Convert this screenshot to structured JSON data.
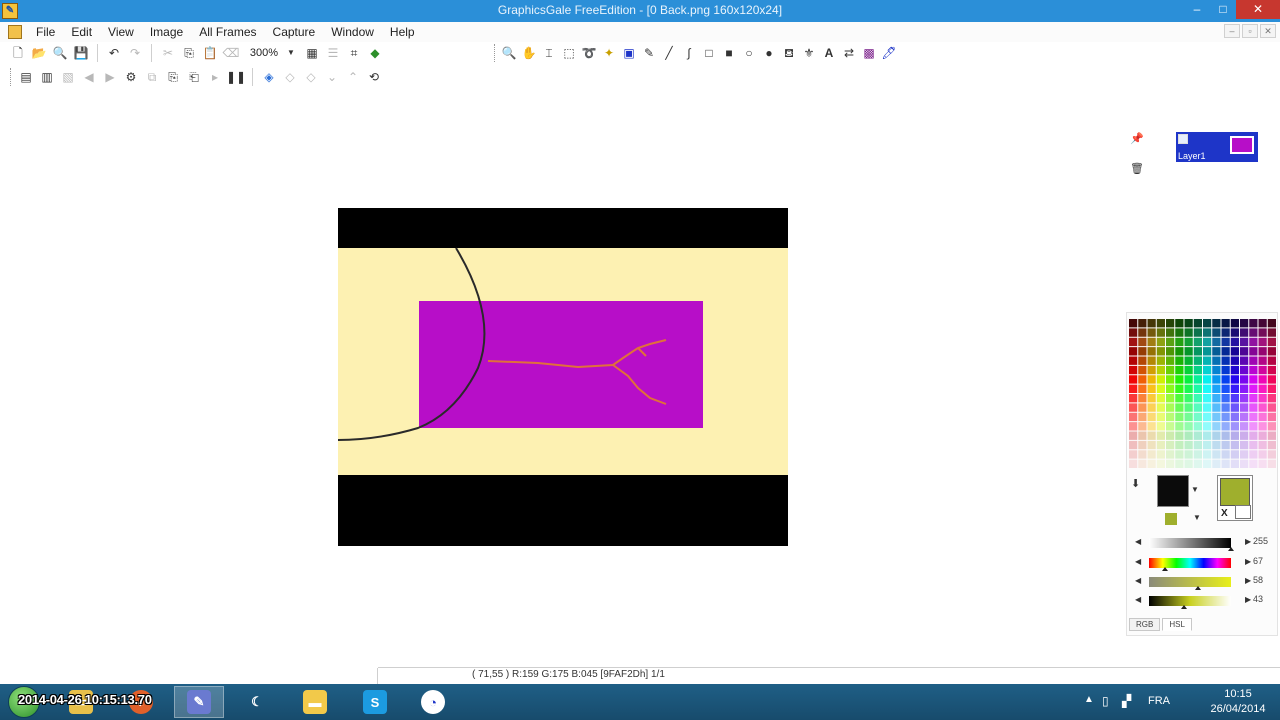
{
  "window": {
    "title": "GraphicsGale FreeEdition - [0 Back.png 160x120x24]",
    "controls": {
      "minimize": "–",
      "maximize": "□",
      "close": "✕"
    }
  },
  "menu": {
    "items": [
      "File",
      "Edit",
      "View",
      "Image",
      "All Frames",
      "Capture",
      "Window",
      "Help"
    ]
  },
  "mdi_controls": {
    "minimize": "–",
    "restore": "▫",
    "close": "✕"
  },
  "toolbar_main": {
    "zoom": "300%",
    "icons": [
      "new-icon",
      "open-icon",
      "preview-icon",
      "save-icon",
      "undo-icon",
      "redo-icon",
      "cut-icon",
      "copy-icon",
      "paste-icon",
      "delete-icon",
      "grid-icon",
      "guide-icon",
      "crop-icon",
      "transparent-icon"
    ]
  },
  "toolbar_frames": {
    "icons": [
      "frame-props-icon",
      "frame-list-icon",
      "frame-sheet-icon",
      "first-frame-icon",
      "next-frame-icon",
      "playback-settings-icon",
      "add-frame-icon",
      "insert-frame-icon",
      "delete-frame-icon",
      "play-icon",
      "pause-icon",
      "onion-icon",
      "onion-prev-icon",
      "onion-next-icon",
      "nav-prev-icon",
      "nav-next-icon",
      "export-icon"
    ]
  },
  "toolbar_tools": {
    "icons": [
      "zoom-tool-icon",
      "hand-tool-icon",
      "rect-select-icon",
      "select-icon",
      "lasso-icon",
      "magic-wand-icon",
      "color-select-icon",
      "pencil-icon",
      "line-icon",
      "curve-icon",
      "rect-icon",
      "filled-rect-icon",
      "ellipse-icon",
      "filled-ellipse-icon",
      "fill-icon",
      "spray-icon",
      "text-icon",
      "replace-color-icon",
      "gradation-icon",
      "dropper-icon"
    ]
  },
  "layers": {
    "pin": "📌",
    "trash": "🗑",
    "items": [
      {
        "name": "Layer1",
        "visible": true,
        "preview_color": "#b70ec8"
      }
    ]
  },
  "palette": {
    "foreground": "#0b0b0b",
    "background": "#9faf2d",
    "transparent": "#9faf2d",
    "x_label": "X",
    "sliders": [
      {
        "name": "light",
        "value": "255",
        "level": 1.0
      },
      {
        "name": "hue",
        "value": "67",
        "level": 0.19
      },
      {
        "name": "saturation",
        "value": "58",
        "level": 0.6
      },
      {
        "name": "brightness",
        "value": "43",
        "level": 0.43
      }
    ],
    "tabs": [
      "RGB",
      "HSL"
    ],
    "active_tab": "HSL"
  },
  "canvas": {
    "image_colors": {
      "border": "#000000",
      "fill": "#fdf1b2",
      "rect": "#b70ec8",
      "lines": "#e0703a"
    }
  },
  "status": {
    "text": "( 71,55 ) R:159 G:175 B:045 [9FAF2Dh] 1/1"
  },
  "taskbar": {
    "overlay_timestamp": "2014-04-26 10:15:13.70",
    "apps": [
      "explorer-icon",
      "firefox-icon",
      "graphicsgale-icon",
      "speed-icon",
      "folder-icon",
      "skype-icon",
      "clock-app-icon"
    ],
    "active_app": "graphicsgale-icon",
    "language": "FRA",
    "time": "10:15",
    "date": "26/04/2014"
  }
}
